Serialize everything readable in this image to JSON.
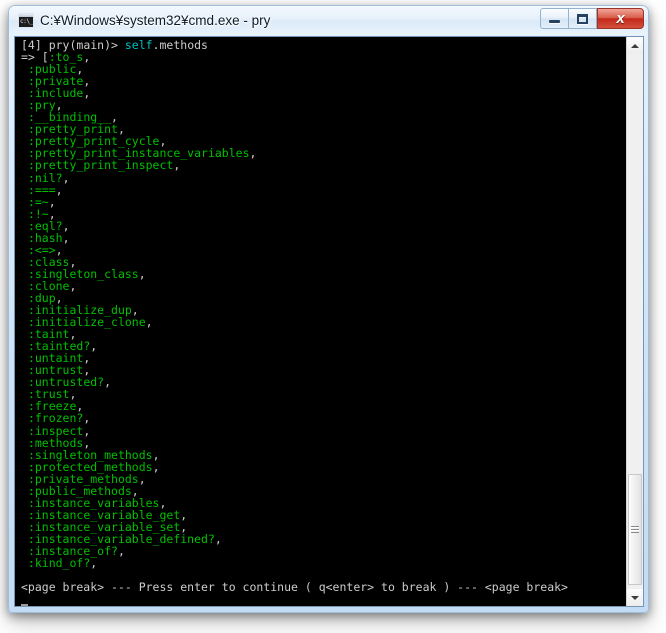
{
  "window": {
    "title": "C:¥Windows¥system32¥cmd.exe - pry",
    "icon_name": "cmd-console-icon",
    "icon_glyph": "c:\\_",
    "colors": {
      "console_background": "#000000",
      "prompt_green": "#00c000",
      "prompt_cyan": "#00c0c0",
      "text_white": "#cccccc",
      "titlebar_text": "#0c1b2a",
      "close_button_red": "#c3281a",
      "aero_border": "#c3dcf4"
    },
    "caption_buttons": [
      {
        "name": "minimize",
        "label": "—"
      },
      {
        "name": "maximize",
        "label": "□"
      },
      {
        "name": "close",
        "label": "✕"
      }
    ]
  },
  "console": {
    "prompt": {
      "index": "[4]",
      "context": " pry(main)> ",
      "receiver": "self",
      "message": ".methods"
    },
    "result_open": "=> [",
    "first_symbol": ":to_s",
    "symbols": [
      ":to_s",
      ":public",
      ":private",
      ":include",
      ":pry",
      ":__binding__",
      ":pretty_print",
      ":pretty_print_cycle",
      ":pretty_print_instance_variables",
      ":pretty_print_inspect",
      ":nil?",
      ":===",
      ":=~",
      ":!~",
      ":eql?",
      ":hash",
      ":<=>",
      ":class",
      ":singleton_class",
      ":clone",
      ":dup",
      ":initialize_dup",
      ":initialize_clone",
      ":taint",
      ":tainted?",
      ":untaint",
      ":untrust",
      ":untrusted?",
      ":trust",
      ":freeze",
      ":frozen?",
      ":inspect",
      ":methods",
      ":singleton_methods",
      ":protected_methods",
      ":private_methods",
      ":public_methods",
      ":instance_variables",
      ":instance_variable_get",
      ":instance_variable_set",
      ":instance_variable_defined?",
      ":instance_of?",
      ":kind_of?"
    ],
    "separator": ",",
    "page_break": "<page break> --- Press enter to continue ( q<enter> to break ) --- <page break>"
  },
  "scrollbar": {
    "up_arrow": "▲",
    "down_arrow": "▼",
    "thumb_name": "scroll-thumb"
  }
}
